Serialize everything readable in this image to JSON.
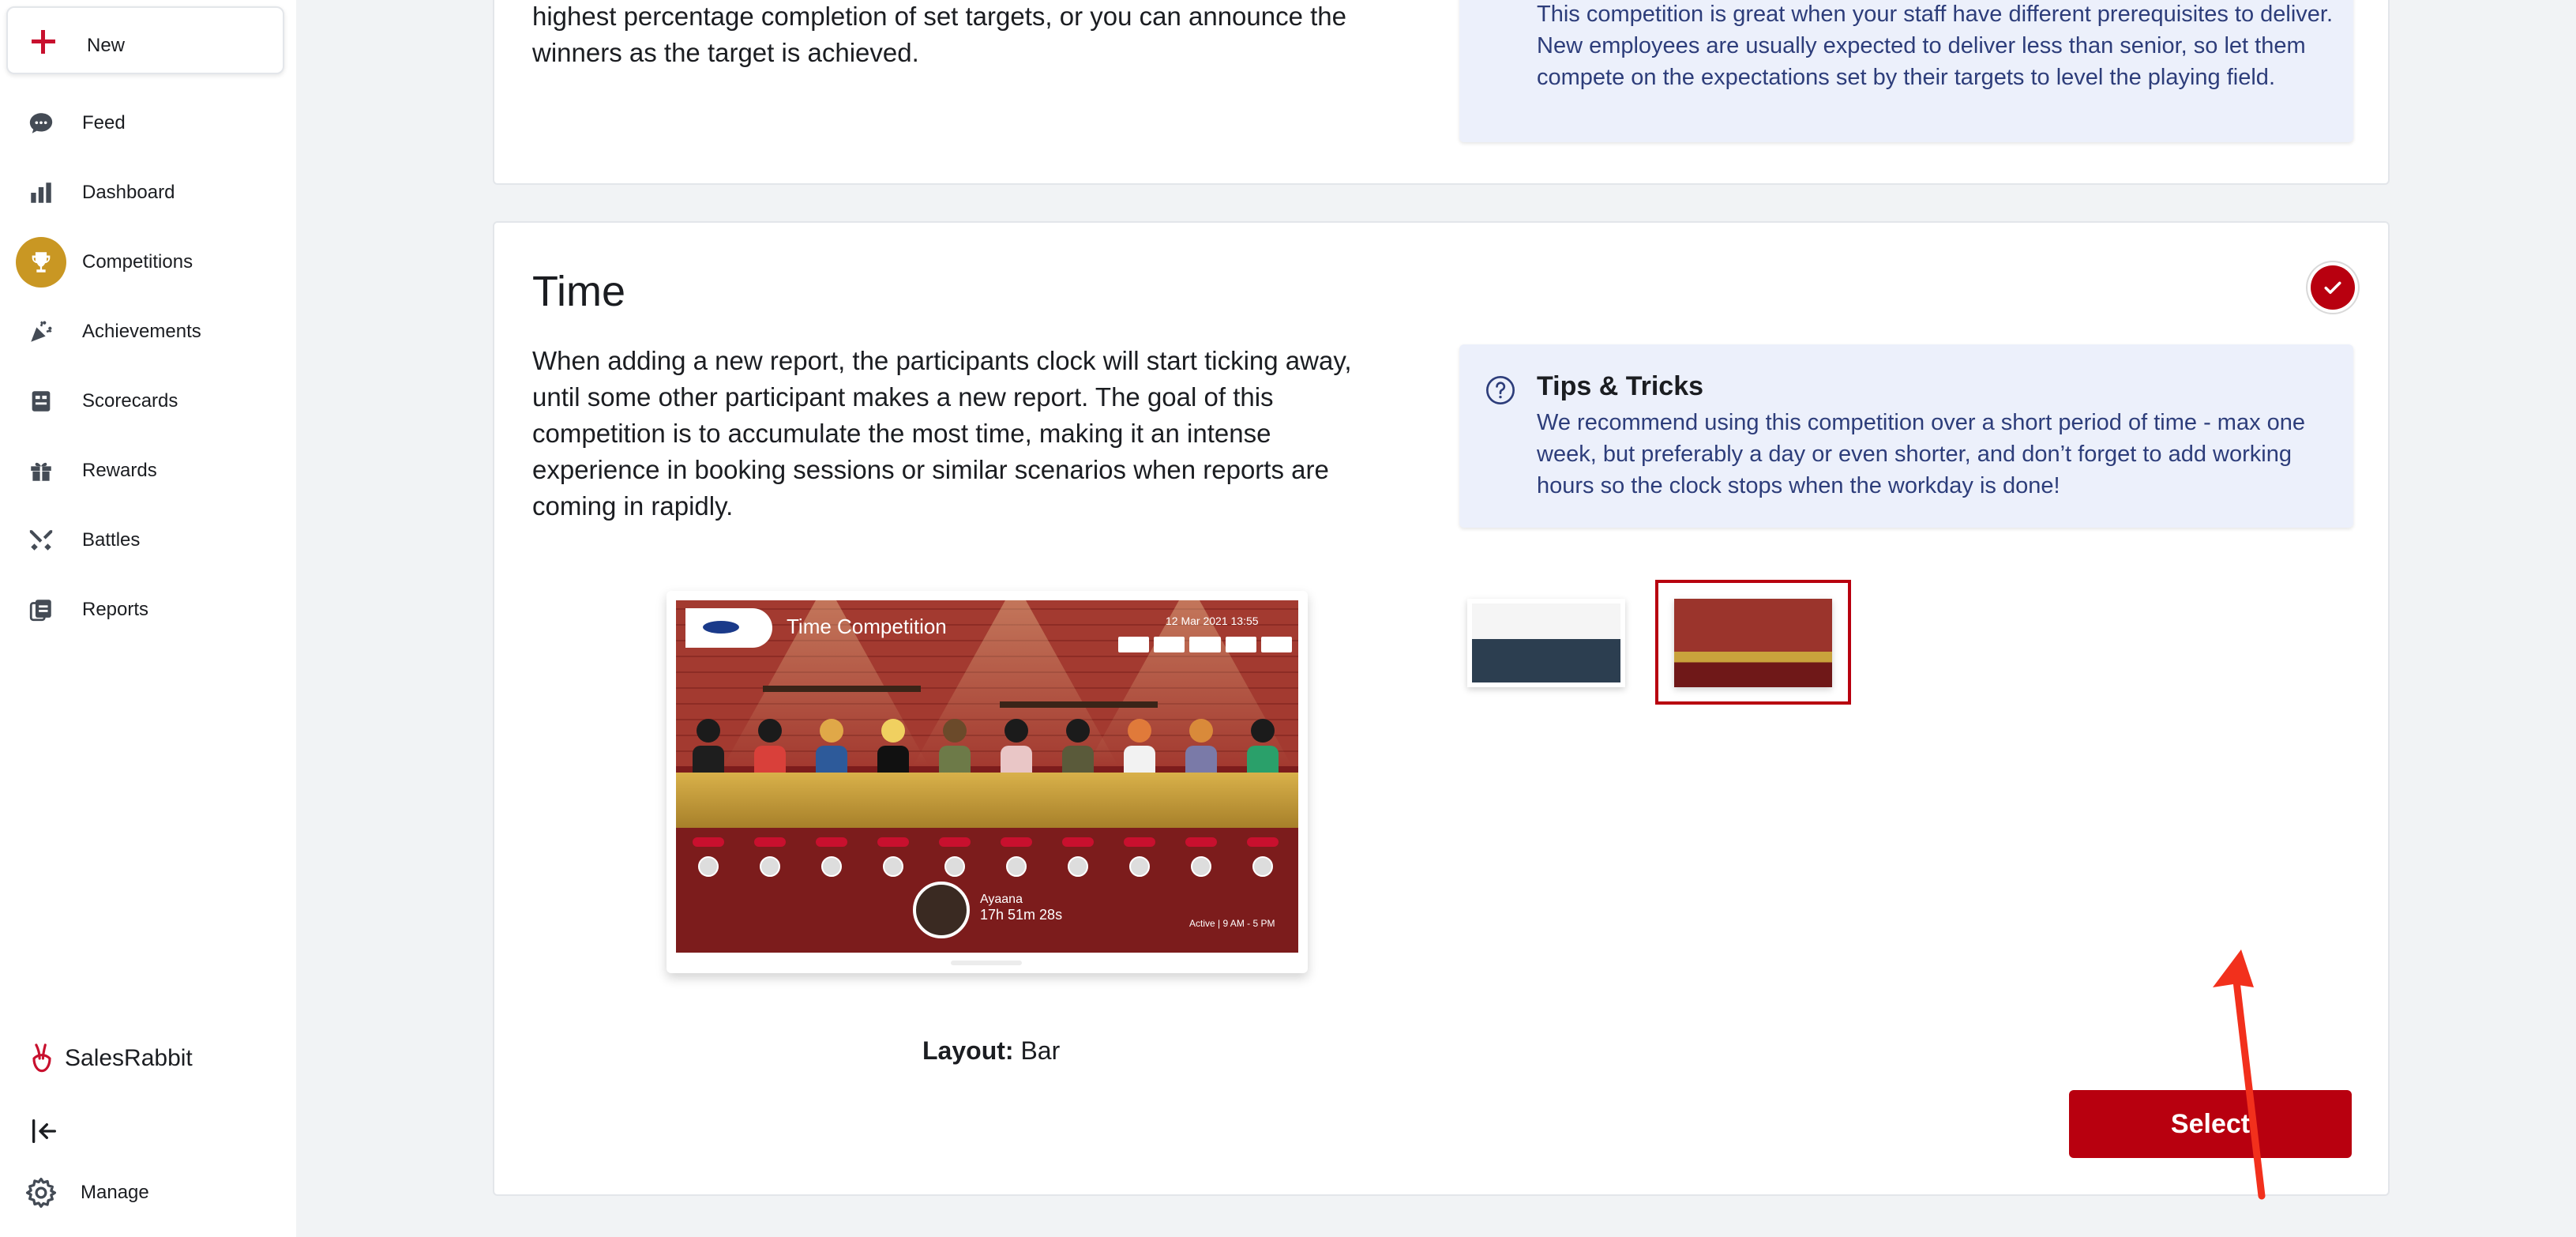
{
  "sidebar": {
    "new_label": "New",
    "items": [
      {
        "label": "Feed",
        "icon": "chat-bubble-icon"
      },
      {
        "label": "Dashboard",
        "icon": "bar-chart-icon"
      },
      {
        "label": "Competitions",
        "icon": "trophy-icon"
      },
      {
        "label": "Achievements",
        "icon": "party-popper-icon"
      },
      {
        "label": "Scorecards",
        "icon": "scorecard-icon"
      },
      {
        "label": "Rewards",
        "icon": "gift-icon"
      },
      {
        "label": "Battles",
        "icon": "crossed-swords-icon"
      },
      {
        "label": "Reports",
        "icon": "reports-icon"
      }
    ],
    "active_item": "Competitions",
    "brand_name": "SalesRabbit",
    "manage_label": "Manage"
  },
  "top_card": {
    "body_text_tail": "highest percentage completion of set targets, or you can announce the winners as the target is achieved.",
    "tip_text_tail": "This competition is great when your staff have different prerequisites to deliver. New employees are usually expected to deliver less than senior, so let them compete on the expectations set by their targets to level the playing field."
  },
  "time_card": {
    "title": "Time",
    "selected": true,
    "description": "When adding a new report, the participants clock will start ticking away, until some other participant makes a new report. The goal of this competition is to accumulate the most time, making it an intense experience in booking sessions or similar scenarios when reports are coming in rapidly.",
    "tips_title": "Tips & Tricks",
    "tips_text": "We recommend using this competition over a short period of time - max one week, but preferably a day or even shorter, and don’t forget to add working hours so the clock stops when the workday is done!",
    "preview": {
      "screen_title": "Time Competition",
      "date": "12 Mar 2021  13:55",
      "leader_name": "Ayaana",
      "leader_time": "17h 51m 28s",
      "status": "Active | 9 AM - 5 PM"
    },
    "layout_label": "Layout:",
    "layout_value": "Bar",
    "select_label": "Select"
  },
  "colors": {
    "accent": "#b8000f",
    "active_nav": "#c99723",
    "tip_bg": "#ecf0fb",
    "tip_text": "#2d3d7a",
    "arrow": "#f2301c"
  }
}
